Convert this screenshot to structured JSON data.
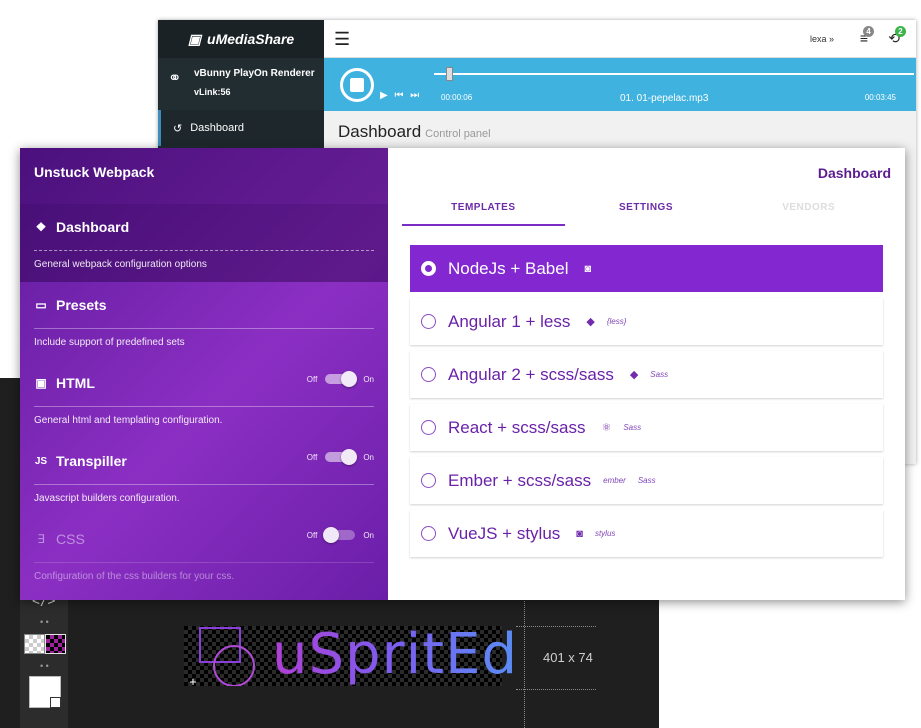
{
  "sprited": {
    "logo": "uSpritEd",
    "size_label": "401 x 74",
    "code_tool": "</>"
  },
  "ums": {
    "brand": "uMediaShare",
    "renderer_name": "vBunny PlayOn Renderer",
    "renderer_link": "vLink:56",
    "nav_dashboard": "Dashboard",
    "user": "lexa »",
    "badge_queue": "4",
    "badge_sync": "2",
    "time_current": "00:00:06",
    "track_file": "01. 01-pepelac.mp3",
    "time_duration": "00:03:45",
    "progress": 0.03,
    "heading": "Dashboard",
    "subheading": "Control panel",
    "colors": {
      "player": "#3fb2e0",
      "sidebar": "#222d32"
    }
  },
  "uw": {
    "title": "Unstuck Webpack",
    "main_title": "Dashboard",
    "toggle_off": "Off",
    "toggle_on": "On",
    "sections": [
      {
        "icon": "dropbox-icon",
        "glyph": "❖",
        "title": "Dashboard",
        "desc": "General webpack configuration options"
      },
      {
        "icon": "presets-icon",
        "glyph": "▭",
        "title": "Presets",
        "desc": "Include support of predefined sets"
      },
      {
        "icon": "html5-icon",
        "glyph": "▣",
        "title": "HTML",
        "desc": "General html and templating configuration.",
        "enabled": true
      },
      {
        "icon": "js-icon",
        "glyph": "JS",
        "title": "Transpiller",
        "desc": "Javascript builders configuration.",
        "enabled": true
      },
      {
        "icon": "css3-icon",
        "glyph": "∃",
        "title": "CSS",
        "desc": "Configuration of the css builders for your css.",
        "enabled": false
      }
    ],
    "tabs": [
      "TEMPLATES",
      "SETTINGS",
      "VENDORS"
    ],
    "templates": [
      {
        "label": "NodeJs + Babel",
        "tags": [
          "◙"
        ],
        "selected": true
      },
      {
        "label": "Angular 1 + less",
        "tags": [
          "◆",
          "{less}"
        ]
      },
      {
        "label": "Angular 2 + scss/sass",
        "tags": [
          "◆",
          "Sass"
        ]
      },
      {
        "label": "React + scss/sass",
        "tags": [
          "⚛",
          "Sass"
        ]
      },
      {
        "label": "Ember + scss/sass",
        "tags": [
          "ember",
          "Sass"
        ]
      },
      {
        "label": "VueJS + stylus",
        "tags": [
          "◙",
          "stylus"
        ]
      }
    ],
    "colors": {
      "panel": "#7a27b8",
      "accent": "#8327d1",
      "text": "#6a22a8"
    }
  }
}
